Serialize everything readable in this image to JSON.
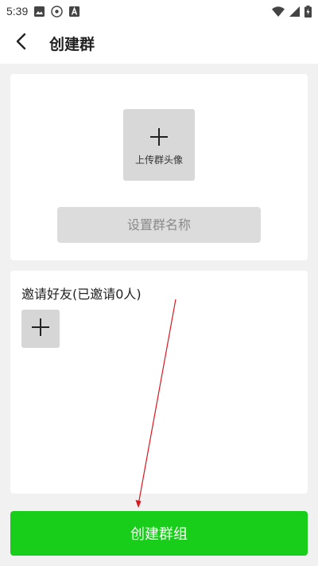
{
  "status_bar": {
    "time": "5:39"
  },
  "header": {
    "title": "创建群"
  },
  "avatar_card": {
    "upload_label": "上传群头像",
    "group_name_placeholder": "设置群名称"
  },
  "invite_card": {
    "title": "邀请好友(已邀请0人)"
  },
  "actions": {
    "create_label": "创建群组"
  },
  "colors": {
    "primary_green": "#19cd1b",
    "annotation_red": "#d9181f",
    "card_bg": "#ffffff",
    "page_bg": "#f1f1f1"
  },
  "icons": {
    "back": "chevron-left-icon",
    "upload": "plus-icon",
    "invite_add": "plus-icon"
  }
}
